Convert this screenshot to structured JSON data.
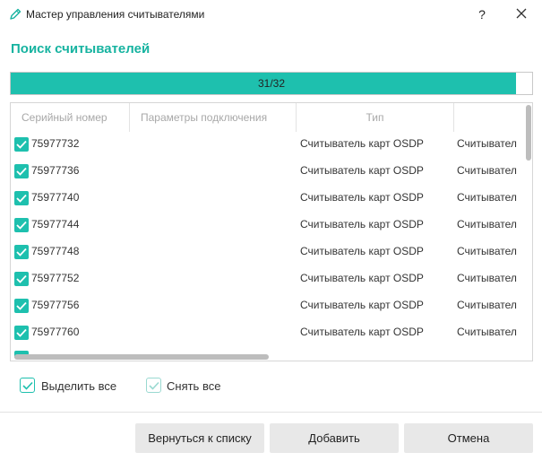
{
  "window": {
    "title": "Мастер управления считывателями",
    "help_label": "?",
    "icon": "pencil-icon"
  },
  "heading": "Поиск считывателей",
  "progress": {
    "label": "31/32",
    "current": 31,
    "total": 32,
    "color": "#1ec0ae"
  },
  "grid": {
    "columns": [
      "Серийный номер",
      "Параметры подключения",
      "Тип",
      ""
    ],
    "rows": [
      {
        "checked": true,
        "serial": "75977732",
        "params": "",
        "type": "Считыватель карт OSDP",
        "extra": "Считывател"
      },
      {
        "checked": true,
        "serial": "75977736",
        "params": "",
        "type": "Считыватель карт OSDP",
        "extra": "Считывател"
      },
      {
        "checked": true,
        "serial": "75977740",
        "params": "",
        "type": "Считыватель карт OSDP",
        "extra": "Считывател"
      },
      {
        "checked": true,
        "serial": "75977744",
        "params": "",
        "type": "Считыватель карт OSDP",
        "extra": "Считывател"
      },
      {
        "checked": true,
        "serial": "75977748",
        "params": "",
        "type": "Считыватель карт OSDP",
        "extra": "Считывател"
      },
      {
        "checked": true,
        "serial": "75977752",
        "params": "",
        "type": "Считыватель карт OSDP",
        "extra": "Считывател"
      },
      {
        "checked": true,
        "serial": "75977756",
        "params": "",
        "type": "Считыватель карт OSDP",
        "extra": "Считывател"
      },
      {
        "checked": true,
        "serial": "75977760",
        "params": "",
        "type": "Считыватель карт OSDP",
        "extra": "Считывател"
      }
    ]
  },
  "select_all": {
    "label": "Выделить все",
    "checked": true
  },
  "deselect_all": {
    "label": "Снять все",
    "checked": true
  },
  "buttons": {
    "back": "Вернуться к списку",
    "add": "Добавить",
    "cancel": "Отмена"
  },
  "colors": {
    "accent": "#1ec0ae",
    "heading": "#16b3a0"
  }
}
